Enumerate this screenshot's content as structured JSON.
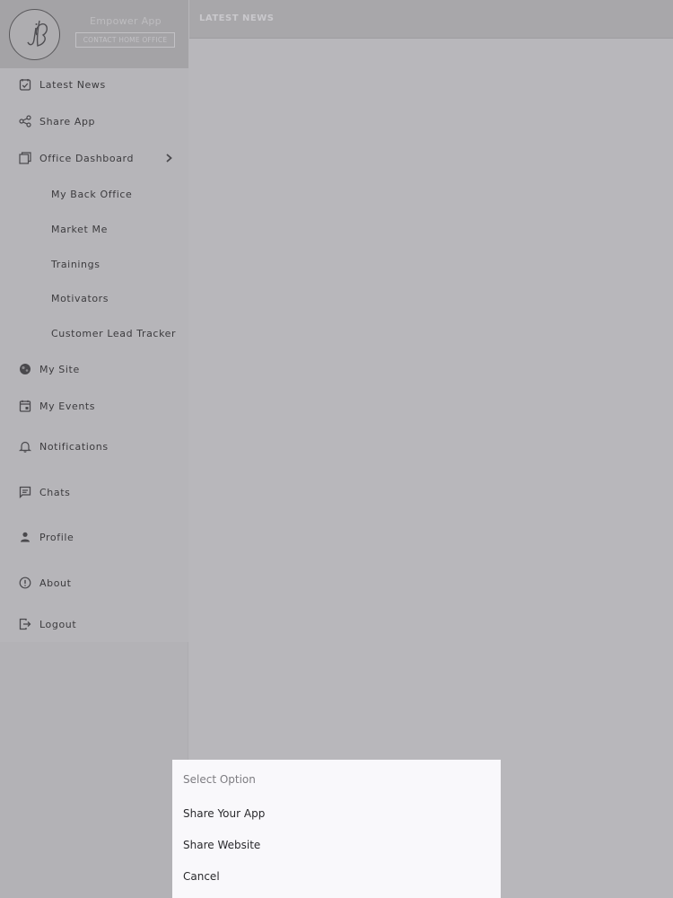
{
  "header": {
    "section_title": "LATEST NEWS"
  },
  "sidebar": {
    "app_name": "Empower App",
    "contact_button_label": "CONTACT HOME OFFICE",
    "logo_text": "jB",
    "items": [
      {
        "label": "Latest News",
        "icon": "news-icon"
      },
      {
        "label": "Share App",
        "icon": "share-icon"
      },
      {
        "label": "Office Dashboard",
        "icon": "dashboard-icon"
      },
      {
        "label": "My Back Office"
      },
      {
        "label": "Market Me"
      },
      {
        "label": "Trainings"
      },
      {
        "label": "Motivators"
      },
      {
        "label": "Customer Lead Tracker"
      },
      {
        "label": "My Site",
        "icon": "globe-icon"
      },
      {
        "label": "My Events",
        "icon": "calendar-icon"
      },
      {
        "label": "Notifications",
        "icon": "bell-icon"
      },
      {
        "label": "Chats",
        "icon": "chat-icon"
      },
      {
        "label": "Profile",
        "icon": "person-icon"
      },
      {
        "label": "About",
        "icon": "info-icon"
      },
      {
        "label": "Logout",
        "icon": "logout-icon"
      }
    ]
  },
  "action_sheet": {
    "title": "Select Option",
    "options": [
      "Share Your App",
      "Share Website",
      "Cancel"
    ]
  },
  "colors": {
    "overlay_gray": "#b7b6ba",
    "sheet_bg": "#f9f8fb",
    "menu_text": "#3c3b3e"
  }
}
